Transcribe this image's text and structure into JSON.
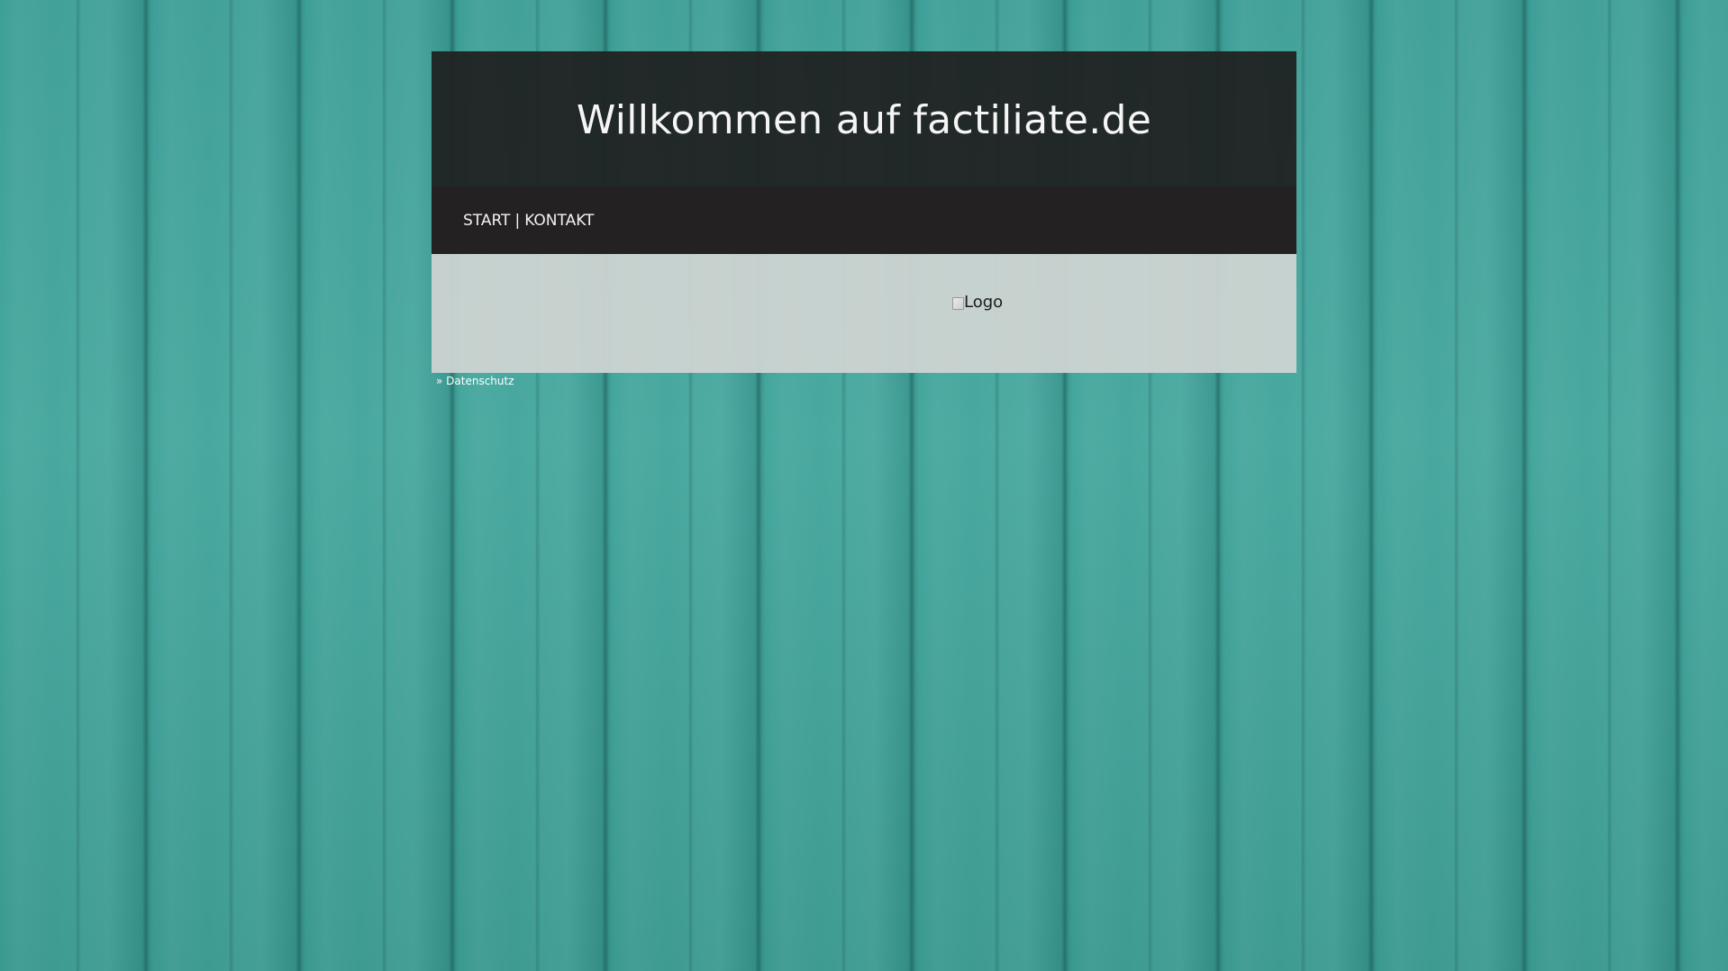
{
  "header": {
    "title": "Willkommen auf factiliate.de"
  },
  "nav": {
    "items": [
      {
        "label": "START"
      },
      {
        "label": "KONTAKT"
      }
    ],
    "separator": "|"
  },
  "content": {
    "logo_alt": "Logo"
  },
  "footer": {
    "link_prefix": "» ",
    "link_label": "Datenschutz"
  },
  "colors": {
    "background": "#3c9e96",
    "header_bg": "#202323",
    "nav_bg": "#242122",
    "content_bg": "#cdd4d2",
    "text_light": "#f5f5f5"
  }
}
